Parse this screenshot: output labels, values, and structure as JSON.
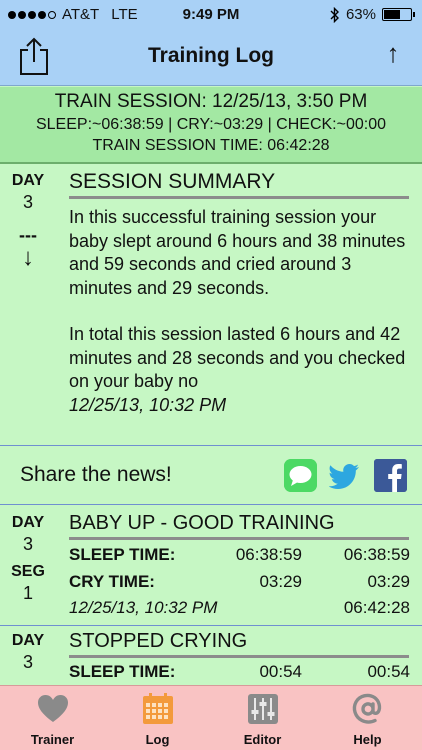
{
  "status_bar": {
    "carrier": "AT&T",
    "network": "LTE",
    "time": "9:49 PM",
    "battery_percent": "63%",
    "battery_level": 0.63,
    "signal_bars_filled": 4
  },
  "nav": {
    "title": "Training Log",
    "up_button_label": "↑"
  },
  "session": {
    "line1": "TRAIN SESSION: 12/25/13, 3:50 PM",
    "line2": "SLEEP:~06:38:59 | CRY:~03:29 | CHECK:~00:00",
    "line3": "TRAIN SESSION TIME: 06:42:28"
  },
  "summary": {
    "day_label": "DAY",
    "day_value": "3",
    "dash": "---",
    "arrow": "↓",
    "title": "SESSION SUMMARY",
    "paragraph1": "In this successful training session your baby slept around 6 hours and 38 minutes and 59 seconds and cried around 3 minutes and 29 seconds.",
    "paragraph2": "In total this session lasted 6 hours and 42 minutes and 28 seconds and you checked on your baby no",
    "timestamp": "12/25/13, 10:32 PM"
  },
  "share": {
    "label": "Share the news!",
    "icons": [
      "message-icon",
      "twitter-icon",
      "facebook-icon"
    ]
  },
  "events": [
    {
      "day_label": "DAY",
      "day_value": "3",
      "seg_label": "SEG",
      "seg_value": "1",
      "title": "BABY UP - GOOD TRAINING",
      "sleep_label": "SLEEP TIME:",
      "sleep_value": "06:38:59",
      "sleep_total": "06:38:59",
      "cry_label": "CRY TIME:",
      "cry_value": "03:29",
      "cry_total": "03:29",
      "timestamp": "12/25/13, 10:32 PM",
      "elapsed": "06:42:28"
    },
    {
      "day_label": "DAY",
      "day_value": "3",
      "title": "STOPPED CRYING",
      "sleep_label": "SLEEP TIME:",
      "sleep_value": "00:54",
      "sleep_total": "00:54"
    }
  ],
  "tabs": [
    {
      "label": "Trainer",
      "icon": "heart-icon",
      "active": false
    },
    {
      "label": "Log",
      "icon": "calendar-icon",
      "active": true
    },
    {
      "label": "Editor",
      "icon": "sliders-icon",
      "active": false
    },
    {
      "label": "Help",
      "icon": "at-sign-icon",
      "active": false
    }
  ],
  "colors": {
    "nav_bg": "#a9d1f6",
    "content_bg": "#c6f7c4",
    "session_bg": "#a3e8a3",
    "tabbar_bg": "#f9c3c3",
    "active_tab": "#f39a3c",
    "inactive_tab": "#8a8a8a",
    "divider": "#6f8fd0"
  }
}
